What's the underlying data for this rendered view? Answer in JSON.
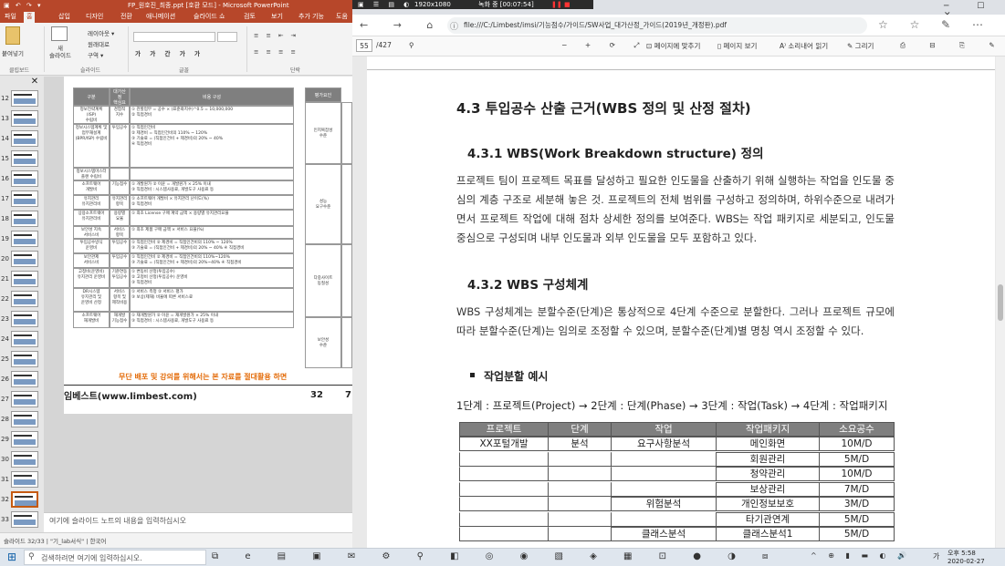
{
  "ppt": {
    "title": "FP_원호진_최종.ppt [호환 모드] - Microsoft PowerPoint",
    "quick_access": "▣ ↶ ↷ ▾",
    "tabs": [
      "파일",
      "홈",
      "삽입",
      "디자인",
      "전환",
      "애니메이션",
      "슬라이드 쇼",
      "검토",
      "보기",
      "추가 기능",
      "도움"
    ],
    "ribbon": {
      "paste": "붙여넣기",
      "new_slide": "새\n슬라이드",
      "layout": "레이아웃 ▾",
      "reset": "원래대로",
      "section": "구역 ▾",
      "groups": [
        "클립보드",
        "슬라이드",
        "글꼴",
        "단락"
      ]
    },
    "slide_numbers": [
      "12",
      "13",
      "14",
      "15",
      "16",
      "17",
      "18",
      "19",
      "20",
      "21",
      "22",
      "23",
      "24",
      "25",
      "26",
      "27",
      "28",
      "29",
      "30",
      "31",
      "32",
      "33"
    ],
    "selected_slide": "32",
    "slide": {
      "header": [
        "구분",
        "대가산정\n핵심요소",
        "비용 구성"
      ],
      "right_header": "평가요인",
      "rows": [
        {
          "a": "정보전략계획\n(ISP)\n수립비",
          "b": "경험적\n지수",
          "c": "① 관할업무 = 공수 × (표준화지수)^0.5 = 10,000,000\n② 직접경비"
        },
        {
          "a": "정보시스템계획 및\n업무재설계\n(BPR/ISP) 수립비",
          "b": "투입공수",
          "c": "① 직접인건비\n② 제경비 = 직접인건비의 110% ~ 120%\n③ 기술료 = (직접인건비 + 제경비)의 20% ~ 40%\n④ 직접경비"
        },
        {
          "a": "정보시스템마스터\n플랜 수립비",
          "b": "",
          "c": ""
        },
        {
          "a": "소프트웨어\n개발비",
          "b": "기능점수",
          "c": "① 개발원가  ② 이윤 = 개발원가 × 25% 이내\n③ 직접경비 : 시스템사용료, 개발도구 사용료 등"
        },
        {
          "a": "유지관리\n유지관리비",
          "b": "유지관리\n항목",
          "c": "① 소프트웨어 개발비 × 유지관리 난이도(%)\n② 직접경비"
        },
        {
          "a": "상용소프트웨어\n유지관리비",
          "b": "용량별\n요율",
          "c": "① 최초 License 구매 계약 금액 × 용량별 유지관리요율"
        },
        {
          "a": "보안성 지속\n서비스비",
          "b": "서비스\n항목",
          "c": "① 최초 제품 구매 금액 × 서비스 요율(%)"
        },
        {
          "a": "투입공수방식\n운영비",
          "b": "투입공수",
          "c": "① 직접인건비 ② 제경비 = 직접인건비의 110% ~ 120%\n③ 기술료 = (직접인건비 + 제경비)의 20% ~ 40%  ④ 직접경비"
        },
        {
          "a": "보안관제\n서비스비",
          "b": "투입공수",
          "c": "① 직접인건비 ② 제경비 = 직접인건비의 110%~120%\n③ 기술료 = (직접인건비 + 제경비)의 20%~40%  ④ 직접경비"
        },
        {
          "a": "고정비(운영비)\n유지관리 운영비",
          "b": "기준연동\n투입공수",
          "c": "① 변동비 산정(투입공수)\n② 고정비 산정(투입공수) 운영비\n③ 직접경비"
        },
        {
          "a": "DR시스템\n유지관리 및\n운영비 산정",
          "b": "서비스\n항목 및\n제작비용",
          "c": "① 서비스 측정  ② 서비스 평가\n③ 보상(제재) 비율에 따른 서비스료"
        },
        {
          "a": "소프트웨어\n재개발비",
          "b": "재개발\n기능점수",
          "c": "① 재개발원가  ② 이윤 = 재개발원가 × 25% 이내\n③ 직접경비 : 시스템사용료, 개발도구 사용료 등"
        }
      ],
      "right_labels": [
        "인지복잡성\n수준",
        "성능\n요구수준",
        "다중사이트\n동질성",
        "보안성\n수준"
      ],
      "warning": "무단 배포 및 강의를 위해서는 본 자료를 절대활용 하면",
      "footer_brand": "임베스트(www.limbest.com)",
      "page_num": "32",
      "page_num2": "7"
    },
    "notes_placeholder": "여기에 슬라이드 노트의 내용을 입력하십시오",
    "status": "슬라이드 32/33 | \"기_lab서식\" | 한국어"
  },
  "recorder": {
    "resolution": "1920x1080",
    "status": "녹화 중 [00:07:54]"
  },
  "browser": {
    "url": "file:///C:/Limbest/imsi/기능점수/가이드/SW사업_대가산정_가이드(2019년_개정판).pdf",
    "pdf_toolbar": {
      "page_current": "55",
      "page_total": "/427",
      "fit_page": "페이지에 맞추기",
      "page_view": "페이지 보기",
      "read_aloud": "소리내어 읽기",
      "draw": "그리기"
    }
  },
  "document": {
    "h_section": "4.3 투입공수 산출 근거(WBS 정의 및 산정 절차)",
    "h_431": "4.3.1 WBS(Work Breakdown structure) 정의",
    "p_431": "프로젝트 팀이 프로젝트 목표를 달성하고 필요한 인도물을 산출하기 위해 실행하는 작업을 인도물 중심의 계층 구조로 세분해 놓은 것. 프로젝트의 전체 범위를 구성하고 정의하며, 하위수준으로 내려가면서 프로젝트 작업에 대해 점차 상세한 정의를 보여준다. WBS는 작업 패키지로 세분되고, 인도물 중심으로 구성되며 내부 인도물과 외부 인도물을 모두 포함하고 있다.",
    "h_432": "4.3.2 WBS 구성체계",
    "p_432": "WBS 구성체계는 분할수준(단계)은 통상적으로 4단계 수준으로 분할한다. 그러나 프로젝트 규모에 따라 분할수준(단계)는 임의로 조정할 수 있으며, 분할수준(단계)별 명칭 역시 조정할 수 있다.",
    "bullet": "작업분할 예시",
    "levels": "1단계 : 프로젝트(Project) → 2단계 : 단계(Phase) → 3단계 : 작업(Task) → 4단계 : 작업패키지",
    "table": {
      "headers": [
        "프로젝트",
        "단계",
        "작업",
        "작업패키지",
        "소요공수"
      ],
      "rows": [
        [
          "XX포털개발",
          "분석",
          "요구사항분석",
          "메인화면",
          "10M/D"
        ],
        [
          "",
          "",
          "",
          "회원관리",
          "5M/D"
        ],
        [
          "",
          "",
          "",
          "청약관리",
          "10M/D"
        ],
        [
          "",
          "",
          "",
          "보상관리",
          "7M/D"
        ],
        [
          "",
          "",
          "위험분석",
          "개인정보보호",
          "3M/D"
        ],
        [
          "",
          "",
          "",
          "타기관연계",
          "5M/D"
        ],
        [
          "",
          "",
          "클래스분석",
          "클래스분석1",
          "5M/D"
        ]
      ]
    }
  },
  "taskbar": {
    "search_placeholder": "검색하려면 여기에 입력하십시오.",
    "time": "오후 5:58",
    "date": "2020-02-27",
    "ime": "가"
  }
}
